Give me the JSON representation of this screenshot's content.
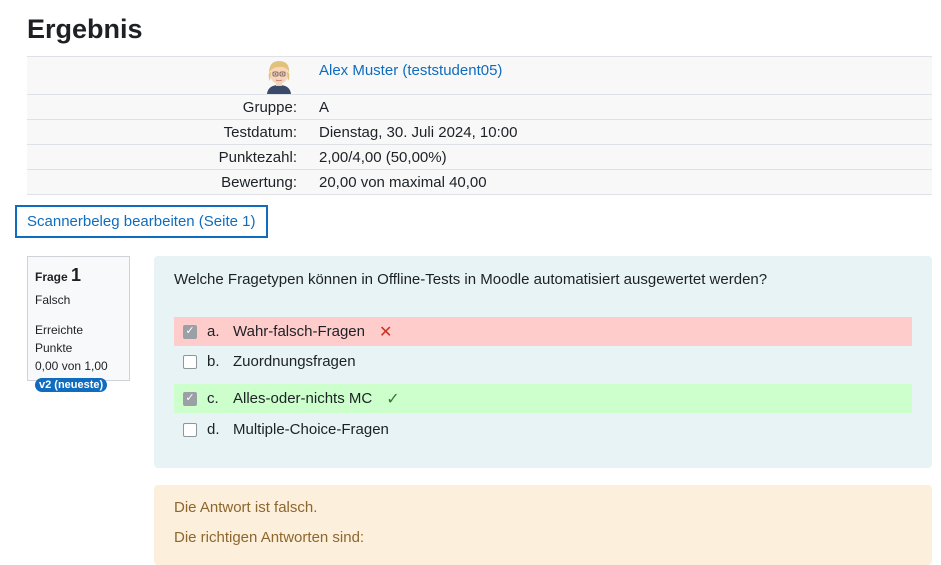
{
  "page": {
    "title": "Ergebnis"
  },
  "summary": {
    "user_name": "Alex Muster (teststudent05)",
    "rows": [
      {
        "label": "Gruppe:",
        "value": "A"
      },
      {
        "label": "Testdatum:",
        "value": "Dienstag, 30. Juli 2024, 10:00"
      },
      {
        "label": "Punktezahl:",
        "value": "2,00/4,00 (50,00%)"
      },
      {
        "label": "Bewertung:",
        "value": "20,00 von maximal 40,00"
      }
    ]
  },
  "scanner_button": "Scannerbeleg bearbeiten (Seite 1)",
  "question": {
    "label": "Frage",
    "number": "1",
    "state": "Falsch",
    "grade_label": "Erreichte Punkte",
    "grade_value": "0,00 von 1,00",
    "version_badge": "v2 (neueste)",
    "text": "Welche Fragetypen können in Offline-Tests in Moodle automatisiert ausgewertet werden?",
    "answers": [
      {
        "letter": "a.",
        "text": "Wahr-falsch-Fragen",
        "checked": true,
        "status": "incorrect",
        "mark_icon": "cross-icon"
      },
      {
        "letter": "b.",
        "text": "Zuordnungsfragen",
        "checked": false,
        "status": "none"
      },
      {
        "letter": "c.",
        "text": "Alles-oder-nichts MC",
        "checked": true,
        "status": "correct",
        "mark_icon": "check-icon"
      },
      {
        "letter": "d.",
        "text": "Multiple-Choice-Fragen",
        "checked": false,
        "status": "none"
      }
    ]
  },
  "feedback": {
    "line1": "Die Antwort ist falsch.",
    "line2": "Die richtigen Antworten sind:"
  },
  "colors": {
    "link": "#0f6cbf",
    "incorrect_bg": "#ffcccc",
    "correct_bg": "#ccffcc",
    "question_bg": "#e7f3f5",
    "feedback_bg": "#fcefdc"
  }
}
